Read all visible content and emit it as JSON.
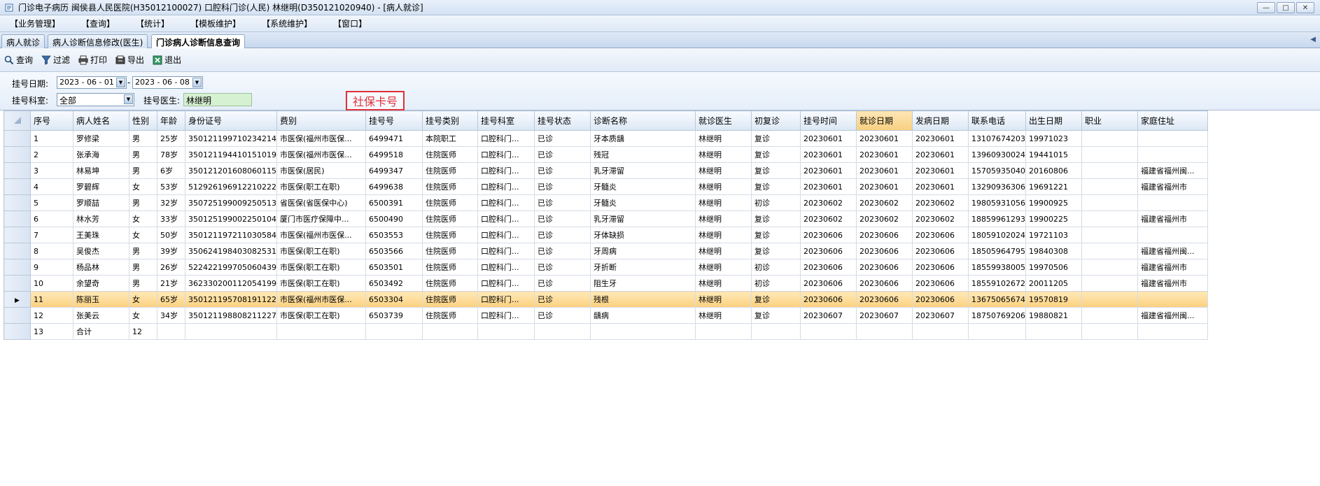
{
  "window": {
    "title": "门诊电子病历  闽侯县人民医院(H35012100027)  口腔科门诊(人民)  林继明(D350121020940) - [病人就诊]",
    "controls": [
      "—",
      "□",
      "✕"
    ]
  },
  "menu": [
    "【业务管理】",
    "【查询】",
    "【统计】",
    "【模板维护】",
    "【系统维护】",
    "【窗口】"
  ],
  "tabs": [
    "病人就诊",
    "病人诊断信息修改(医生)",
    "门诊病人诊断信息查询"
  ],
  "toolbar": {
    "query": "查询",
    "filter": "过滤",
    "print": "打印",
    "export": "导出",
    "exit": "退出"
  },
  "filter": {
    "date_label": "挂号日期:",
    "date_from": "2023 - 06 - 01",
    "date_sep": "-",
    "date_to": "2023 - 06 - 08",
    "dept_label": "挂号科室:",
    "dept_value": "全部",
    "doctor_label": "挂号医生:",
    "doctor_value": "林继明"
  },
  "annotation": "社保卡号",
  "colors": {
    "annotation": "#e0303a",
    "selected_row": "#fcd07f",
    "sorted_header": "#f8cf7f"
  },
  "grid": {
    "columns": [
      "序号",
      "病人姓名",
      "性别",
      "年龄",
      "身份证号",
      "费别",
      "挂号号",
      "挂号类别",
      "挂号科室",
      "挂号状态",
      "诊断名称",
      "就诊医生",
      "初复诊",
      "挂号时间",
      "就诊日期",
      "发病日期",
      "联系电话",
      "出生日期",
      "职业",
      "家庭住址"
    ],
    "selected_index": 10,
    "rows": [
      [
        "1",
        "罗修梁",
        "男",
        "25岁",
        "350121199710234214",
        "市医保(福州市医保...",
        "6499471",
        "本院职工",
        "口腔科门...",
        "已诊",
        "牙本质龋",
        "林继明",
        "复诊",
        "20230601",
        "20230601",
        "20230601",
        "13107674203",
        "19971023",
        "",
        ""
      ],
      [
        "2",
        "张承海",
        "男",
        "78岁",
        "350121194410151019",
        "市医保(福州市医保...",
        "6499518",
        "住院医师",
        "口腔科门...",
        "已诊",
        "残冠",
        "林继明",
        "复诊",
        "20230601",
        "20230601",
        "20230601",
        "13960930024",
        "19441015",
        "",
        ""
      ],
      [
        "3",
        "林易坤",
        "男",
        "6岁",
        "350121201608060115",
        "市医保(居民)",
        "6499347",
        "住院医师",
        "口腔科门...",
        "已诊",
        "乳牙滞留",
        "林继明",
        "复诊",
        "20230601",
        "20230601",
        "20230601",
        "15705935040",
        "20160806",
        "",
        "福建省福州闽..."
      ],
      [
        "4",
        "罗碧辉",
        "女",
        "53岁",
        "512926196912210222",
        "市医保(职工在职)",
        "6499638",
        "住院医师",
        "口腔科门...",
        "已诊",
        "牙髓炎",
        "林继明",
        "复诊",
        "20230601",
        "20230601",
        "20230601",
        "13290936306",
        "19691221",
        "",
        "福建省福州市"
      ],
      [
        "5",
        "罗顺喆",
        "男",
        "32岁",
        "350725199009250513",
        "省医保(省医保中心)",
        "6500391",
        "住院医师",
        "口腔科门...",
        "已诊",
        "牙髓炎",
        "林继明",
        "初诊",
        "20230602",
        "20230602",
        "20230602",
        "19805931056",
        "19900925",
        "",
        ""
      ],
      [
        "6",
        "林水芳",
        "女",
        "33岁",
        "350125199002250104",
        "厦门市医疗保障中...",
        "6500490",
        "住院医师",
        "口腔科门...",
        "已诊",
        "乳牙滞留",
        "林继明",
        "复诊",
        "20230602",
        "20230602",
        "20230602",
        "18859961293",
        "19900225",
        "",
        "福建省福州市"
      ],
      [
        "7",
        "王美珠",
        "女",
        "50岁",
        "350121197211030584",
        "市医保(福州市医保...",
        "6503553",
        "住院医师",
        "口腔科门...",
        "已诊",
        "牙体缺损",
        "林继明",
        "复诊",
        "20230606",
        "20230606",
        "20230606",
        "18059102024",
        "19721103",
        "",
        ""
      ],
      [
        "8",
        "吴俊杰",
        "男",
        "39岁",
        "350624198403082531",
        "市医保(职工在职)",
        "6503566",
        "住院医师",
        "口腔科门...",
        "已诊",
        "牙周病",
        "林继明",
        "复诊",
        "20230606",
        "20230606",
        "20230606",
        "18505964795",
        "19840308",
        "",
        "福建省福州闽..."
      ],
      [
        "9",
        "杨品林",
        "男",
        "26岁",
        "522422199705060439",
        "市医保(职工在职)",
        "6503501",
        "住院医师",
        "口腔科门...",
        "已诊",
        "牙折断",
        "林继明",
        "初诊",
        "20230606",
        "20230606",
        "20230606",
        "18559938005",
        "19970506",
        "",
        "福建省福州市"
      ],
      [
        "10",
        "余望奇",
        "男",
        "21岁",
        "362330200112054199",
        "市医保(职工在职)",
        "6503492",
        "住院医师",
        "口腔科门...",
        "已诊",
        "阻生牙",
        "林继明",
        "初诊",
        "20230606",
        "20230606",
        "20230606",
        "18559102672",
        "20011205",
        "",
        "福建省福州市"
      ],
      [
        "11",
        "陈丽玉",
        "女",
        "65岁",
        "350121195708191122",
        "市医保(福州市医保...",
        "6503304",
        "住院医师",
        "口腔科门...",
        "已诊",
        "残根",
        "林继明",
        "复诊",
        "20230606",
        "20230606",
        "20230606",
        "13675065674",
        "19570819",
        "",
        ""
      ],
      [
        "12",
        "张美云",
        "女",
        "34岁",
        "350121198808211227",
        "市医保(职工在职)",
        "6503739",
        "住院医师",
        "口腔科门...",
        "已诊",
        "龋病",
        "林继明",
        "复诊",
        "20230607",
        "20230607",
        "20230607",
        "18750769206",
        "19880821",
        "",
        "福建省福州闽..."
      ],
      [
        "13",
        "合计",
        "12",
        "",
        "",
        "",
        "",
        "",
        "",
        "",
        "",
        "",
        "",
        "",
        "",
        "",
        "",
        "",
        "",
        ""
      ]
    ]
  }
}
